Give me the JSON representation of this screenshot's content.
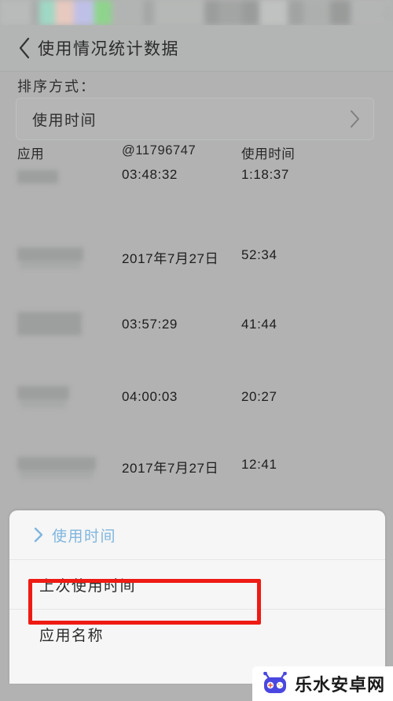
{
  "header": {
    "back_icon": "chevron-left-icon",
    "title": "使用情况统计数据"
  },
  "sort": {
    "label": "排序方式：",
    "selected_value": "使用时间",
    "chevron_icon": "chevron-right-icon"
  },
  "table": {
    "columns": [
      "应用",
      "@11796747",
      "使用时间"
    ],
    "rows": [
      {
        "app": "",
        "last_used": "03:48:32",
        "usage": "1:18:37"
      },
      {
        "app": "",
        "last_used": "2017年7月27日",
        "usage": "52:34"
      },
      {
        "app": "",
        "last_used": "03:57:29",
        "usage": "41:44"
      },
      {
        "app": "",
        "last_used": "04:00:03",
        "usage": "20:27"
      },
      {
        "app": "",
        "last_used": "2017年7月27日",
        "usage": "12:41"
      }
    ]
  },
  "sheet": {
    "options": [
      {
        "label": "使用时间",
        "selected": true,
        "highlighted": false
      },
      {
        "label": "上次使用时间",
        "selected": false,
        "highlighted": true
      },
      {
        "label": "应用名称",
        "selected": false,
        "highlighted": false
      }
    ],
    "chevron_icon": "chevron-right-icon",
    "highlight_color": "#ee1b14",
    "selected_color": "#7fb6de"
  },
  "watermark": {
    "text": "乐水安卓网",
    "icon": "robot-icon",
    "color": "#4a47e0"
  }
}
